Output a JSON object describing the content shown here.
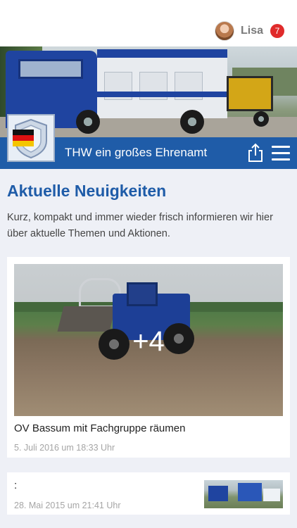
{
  "user": {
    "name": "Lisa",
    "notifications": "7"
  },
  "header": {
    "title": "THW ein großes Ehrenamt"
  },
  "main": {
    "section_title": "Aktuelle Neuigkeiten",
    "section_description": "Kurz, kompakt und immer wieder frisch informieren wir hier über aktuelle Themen und Aktionen."
  },
  "news": [
    {
      "title": "OV Bassum mit Fachgruppe räumen",
      "date": "5. Juli 2016 um 18:33 Uhr",
      "more_images": "+4"
    },
    {
      "title": ":",
      "date": "28. Mai 2015 um 21:41 Uhr"
    }
  ],
  "icons": {
    "share": "share-icon",
    "menu": "hamburger-menu-icon"
  },
  "colors": {
    "brand_blue": "#1f5ca8",
    "badge_red": "#e02b2b",
    "background": "#eef0f6"
  }
}
